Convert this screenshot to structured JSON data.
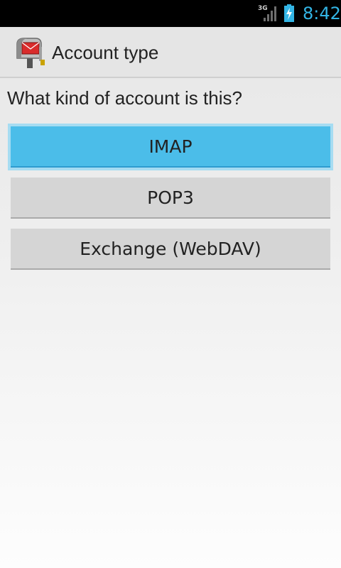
{
  "status_bar": {
    "network": "3G",
    "time": "8:42",
    "icons": [
      "signal-icon",
      "battery-charging-icon"
    ],
    "clock_color": "#33b5e5"
  },
  "action_bar": {
    "icon": "app-icon",
    "title": "Account type"
  },
  "question": "What kind of account is this?",
  "choices": [
    {
      "label": "IMAP",
      "state": "focused"
    },
    {
      "label": "POP3",
      "state": "normal"
    },
    {
      "label": "Exchange (WebDAV)",
      "state": "normal"
    }
  ],
  "colors": {
    "focused_button": "#4bbde9",
    "normal_button": "#d5d5d5"
  }
}
